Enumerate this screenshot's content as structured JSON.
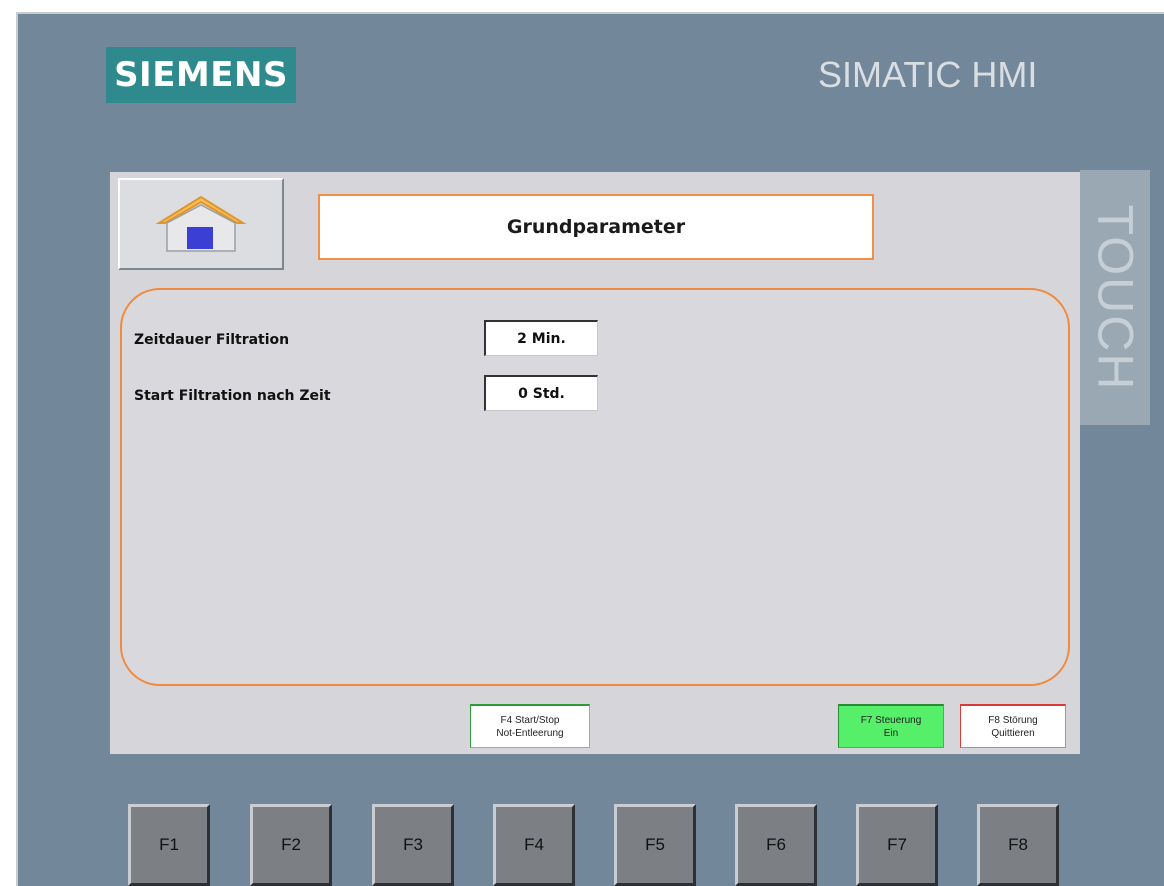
{
  "brand": {
    "logo": "SIEMENS",
    "product": "SIMATIC HMI",
    "touch_label": "TOUCH"
  },
  "header": {
    "home_icon": "home-icon",
    "title": "Grundparameter"
  },
  "params": [
    {
      "label": "Zeitdauer Filtration",
      "value": "2 Min."
    },
    {
      "label": "Start Filtration nach Zeit",
      "value": "0 Std."
    }
  ],
  "softkeys": {
    "f4": {
      "line1": "F4 Start/Stop",
      "line2": "Not-Entleerung"
    },
    "f7": {
      "line1": "F7 Steuerung",
      "line2": "Ein"
    },
    "f8": {
      "line1": "F8 Störung",
      "line2": "Quittieren"
    }
  },
  "function_keys": [
    "F1",
    "F2",
    "F3",
    "F4",
    "F5",
    "F6",
    "F7",
    "F8"
  ],
  "colors": {
    "bezel": "#73879b",
    "screen": "#d6d6da",
    "accent_orange": "#ef8a3f",
    "logo_teal": "#2f8a8e",
    "steuerung_green": "#55ef6a",
    "stoerung_red": "#d83a3a"
  }
}
